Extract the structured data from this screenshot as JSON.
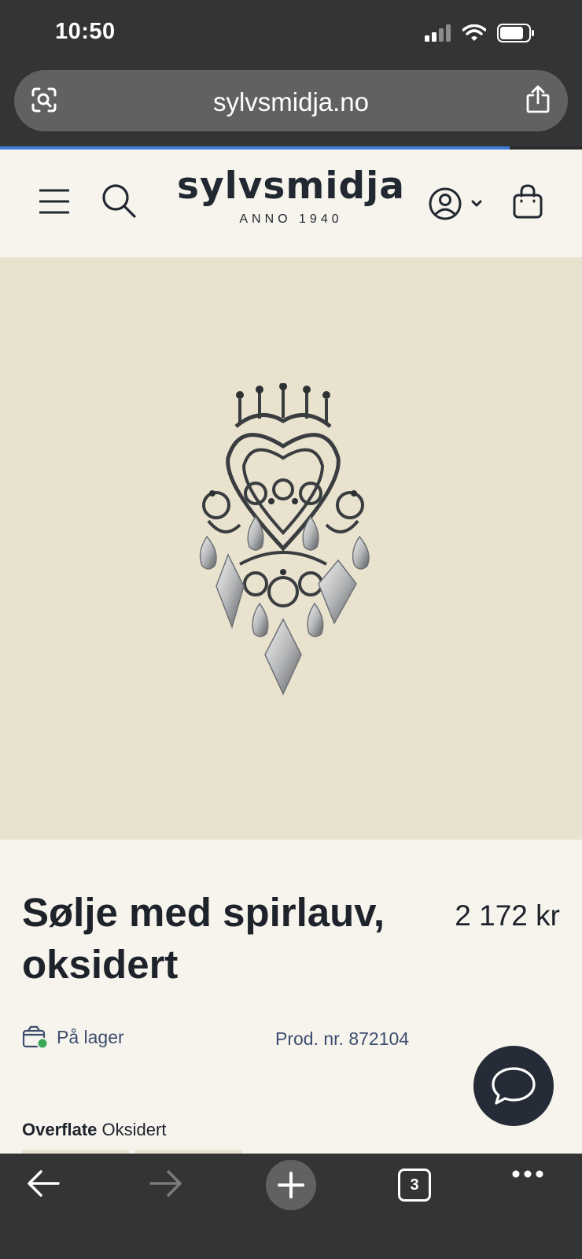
{
  "status_bar": {
    "time": "10:50"
  },
  "browser": {
    "url": "sylvsmidja.no",
    "tab_count": "3"
  },
  "header": {
    "logo_text": "sylvsmidja",
    "logo_subtitle": "ANNO 1940"
  },
  "product": {
    "title": "Sølje med spirlauv, oksidert",
    "price": "2 172 kr",
    "stock_status": "På lager",
    "product_number": "Prod. nr. 872104",
    "surface_label": "Overflate",
    "surface_value": "Oksidert"
  },
  "colors": {
    "header_bg": "#f6f4ec",
    "image_bg": "#e8e2cf",
    "text_dark": "#1d222b",
    "text_muted": "#3e4d6f",
    "chat_button": "#252c37",
    "stock_ok": "#3aa757"
  },
  "icons": {
    "status": [
      "signal-icon",
      "wifi-icon",
      "battery-icon"
    ],
    "url_bar": [
      "lens-icon",
      "share-icon"
    ],
    "header": [
      "menu-icon",
      "search-icon",
      "account-icon",
      "chevron-down-icon",
      "cart-icon"
    ],
    "bottom_bar": [
      "back-icon",
      "forward-icon",
      "plus-icon",
      "tabs-icon",
      "more-icon"
    ],
    "misc": [
      "stock-box-icon",
      "chat-icon"
    ]
  }
}
